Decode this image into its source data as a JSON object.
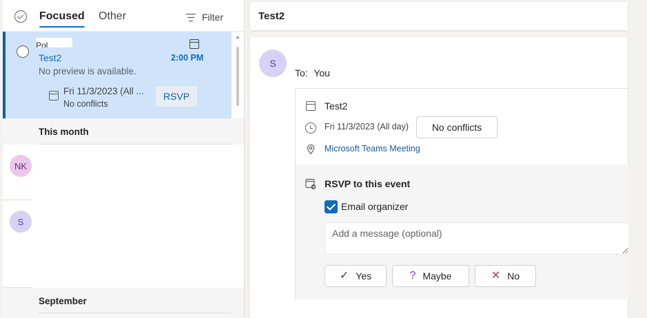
{
  "list_header": {
    "tab_focused": "Focused",
    "tab_other": "Other",
    "filter_label": "Filter"
  },
  "selected_message": {
    "sender": "Pol",
    "subject": "Test2",
    "preview": "No preview is available.",
    "time": "2:00 PM",
    "event_date": "Fri 11/3/2023 (All ...",
    "event_conflict": "No conflicts",
    "rsvp_label": "RSVP"
  },
  "groups": {
    "this_month": "This month",
    "september": "September"
  },
  "avatars": {
    "nk": "NK",
    "s": "S"
  },
  "reading_pane": {
    "subject": "Test2",
    "sender_initial": "S",
    "to_label": "To:",
    "to_value": "You",
    "event": {
      "title": "Test2",
      "date": "Fri 11/3/2023 (All day)",
      "conflict_label": "No conflicts",
      "location": "Microsoft Teams Meeting"
    },
    "rsvp": {
      "title": "RSVP to this event",
      "email_organizer_label": "Email organizer",
      "email_organizer_checked": true,
      "message_placeholder": "Add a message (optional)",
      "yes_label": "Yes",
      "maybe_label": "Maybe",
      "no_label": "No"
    }
  },
  "colors": {
    "accent": "#0f6cbd",
    "selected_bg": "#cfe4fa",
    "decline": "#c4314b",
    "tentative": "#7b3fb3"
  }
}
